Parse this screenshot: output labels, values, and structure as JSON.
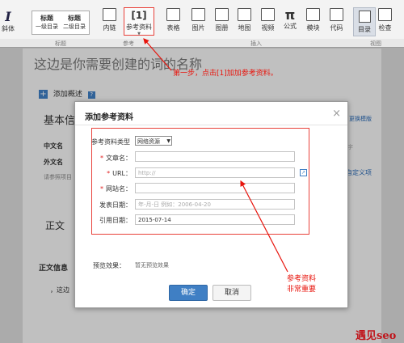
{
  "toolbar": {
    "italic": "I",
    "italic_label": "斜体",
    "heading1": "标题",
    "heading1_sub": "一级目录",
    "heading2": "标题",
    "heading2_sub": "二级目录",
    "inner_chain": "内链",
    "reference_icon": "[1]",
    "reference_label": "参考资料",
    "table": "表格",
    "image": "图片",
    "album": "图册",
    "map": "地图",
    "video": "视频",
    "formula_icon": "π",
    "formula": "公式",
    "module": "模块",
    "code": "代码",
    "catalog": "目录",
    "check": "检查"
  },
  "group_labels": {
    "title": "标题",
    "reference": "参考",
    "insert": "插入",
    "view": "视图"
  },
  "doc": {
    "page_title": "这边是你需要创建的词的名称",
    "add_summary": "添加概述",
    "basic_info": "基本信",
    "chinese_name": "中文名",
    "foreign_name": "外文名",
    "ref_hint": "请参照项目",
    "change_template": "更换模版",
    "custom_item": "自定义项",
    "char_hint": "字",
    "body_text_heading": "正文",
    "body_info": "正文信息",
    "body_bullet": "，这边"
  },
  "dialog": {
    "title": "添加参考资料",
    "close": "×",
    "type_label": "参考资料类型",
    "type_value": "网络资源",
    "article_label": "文章名：",
    "url_label": "URL：",
    "url_placeholder": "http://",
    "site_label": "网站名：",
    "publish_label": "发表日期：",
    "publish_placeholder": "年-月-日 例如：2006-04-20",
    "cite_label": "引用日期：",
    "cite_value": "2015-07-14",
    "preview_label": "预览效果：",
    "preview_value": "暂无预览效果",
    "confirm": "确定",
    "cancel": "取消"
  },
  "annotations": {
    "step1": "第一步，点击[1]加加参考资料。",
    "important_line1": "参考资料",
    "important_line2": "非常重要",
    "watermark": "遇见seo"
  },
  "colors": {
    "red": "#e8140c",
    "blue": "#3f7fc4"
  }
}
